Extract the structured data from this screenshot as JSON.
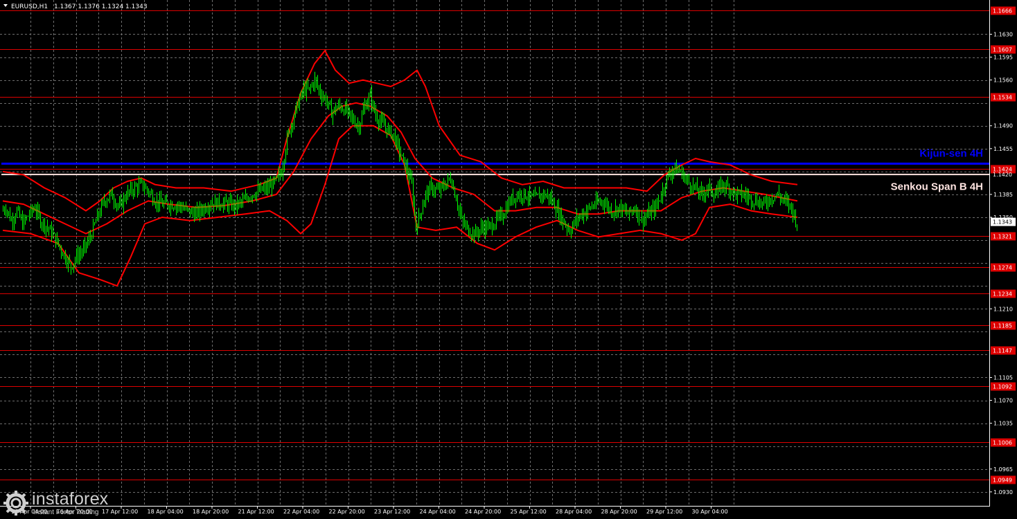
{
  "header": {
    "symbol": "EURUSD,H1",
    "ohlc": "1.1367 1.1376 1.1324 1.1343"
  },
  "watermark": {
    "brand": "instaforex",
    "tagline": "Instant Forex Trading"
  },
  "colors": {
    "background": "#000000",
    "grid": "#6e6e6e",
    "candle": "#00ff00",
    "bands": "#ff0000",
    "level": "#dd0000",
    "kijun": "#0000ff",
    "senkou": "#ffe4e1",
    "axis_text": "#ffffff",
    "label_text": "#ff3b3b"
  },
  "chart_data": {
    "type": "line",
    "title": "EURUSD,H1",
    "y_range": [
      1.0915,
      1.1676
    ],
    "y_ticks": [
      "1.1630",
      "1.1595",
      "1.1560",
      "1.1525",
      "1.1490",
      "1.1455",
      "1.1420",
      "1.1385",
      "1.1350",
      "1.1315",
      "1.1280",
      "1.1245",
      "1.1210",
      "1.1175",
      "1.1140",
      "1.1105",
      "1.1070",
      "1.1035",
      "1.1000",
      "1.0965",
      "1.0930"
    ],
    "x_tick_labels": [
      "16 Apr 04:00",
      "16 Apr 20:00",
      "17 Apr 12:00",
      "18 Apr 04:00",
      "18 Apr 20:00",
      "21 Apr 12:00",
      "22 Apr 04:00",
      "22 Apr 20:00",
      "23 Apr 12:00",
      "24 Apr 04:00",
      "24 Apr 20:00",
      "25 Apr 12:00",
      "28 Apr 04:00",
      "28 Apr 20:00",
      "29 Apr 12:00",
      "30 Apr 04:00"
    ],
    "current_price": "1.1343",
    "levels": [
      {
        "value": 1.1666,
        "label": "1.1666"
      },
      {
        "value": 1.1607,
        "label": "1.1607"
      },
      {
        "value": 1.1534,
        "label": "1.1534"
      },
      {
        "value": 1.1424,
        "label": "1.1424"
      },
      {
        "value": 1.1321,
        "label": "1.1321"
      },
      {
        "value": 1.1274,
        "label": "1.1274"
      },
      {
        "value": 1.1234,
        "label": "1.1234"
      },
      {
        "value": 1.1185,
        "label": "1.1185"
      },
      {
        "value": 1.1147,
        "label": "1.1147"
      },
      {
        "value": 1.1092,
        "label": "1.1092"
      },
      {
        "value": 1.1006,
        "label": "1.1006"
      },
      {
        "value": 1.0949,
        "label": "1.0949"
      }
    ],
    "kijun": {
      "name": "Kijun-sen 4H",
      "value": 1.1432
    },
    "senkou": {
      "name": "Senkou Span B 4H",
      "value": 1.1424
    },
    "senkou_tick": "1.1420",
    "price_path": [
      {
        "t": 0,
        "v": 1.136
      },
      {
        "t": 6,
        "v": 1.1365
      },
      {
        "t": 14,
        "v": 1.1345
      },
      {
        "t": 22,
        "v": 1.136
      },
      {
        "t": 30,
        "v": 1.134
      },
      {
        "t": 40,
        "v": 1.1355
      },
      {
        "t": 48,
        "v": 1.1365
      },
      {
        "t": 56,
        "v": 1.1345
      },
      {
        "t": 66,
        "v": 1.1335
      },
      {
        "t": 76,
        "v": 1.132
      },
      {
        "t": 86,
        "v": 1.13
      },
      {
        "t": 94,
        "v": 1.1285
      },
      {
        "t": 100,
        "v": 1.1275
      },
      {
        "t": 108,
        "v": 1.129
      },
      {
        "t": 118,
        "v": 1.13
      },
      {
        "t": 128,
        "v": 1.132
      },
      {
        "t": 138,
        "v": 1.135
      },
      {
        "t": 148,
        "v": 1.1375
      },
      {
        "t": 158,
        "v": 1.1385
      },
      {
        "t": 170,
        "v": 1.1365
      },
      {
        "t": 180,
        "v": 1.1385
      },
      {
        "t": 192,
        "v": 1.1395
      },
      {
        "t": 202,
        "v": 1.14
      },
      {
        "t": 212,
        "v": 1.139
      },
      {
        "t": 222,
        "v": 1.1375
      },
      {
        "t": 232,
        "v": 1.137
      },
      {
        "t": 244,
        "v": 1.137
      },
      {
        "t": 256,
        "v": 1.1368
      },
      {
        "t": 268,
        "v": 1.136
      },
      {
        "t": 280,
        "v": 1.1355
      },
      {
        "t": 292,
        "v": 1.1365
      },
      {
        "t": 302,
        "v": 1.1372
      },
      {
        "t": 314,
        "v": 1.1372
      },
      {
        "t": 326,
        "v": 1.137
      },
      {
        "t": 338,
        "v": 1.1368
      },
      {
        "t": 350,
        "v": 1.1375
      },
      {
        "t": 360,
        "v": 1.1385
      },
      {
        "t": 372,
        "v": 1.139
      },
      {
        "t": 384,
        "v": 1.1395
      },
      {
        "t": 396,
        "v": 1.1405
      },
      {
        "t": 404,
        "v": 1.142
      },
      {
        "t": 412,
        "v": 1.147
      },
      {
        "t": 420,
        "v": 1.15
      },
      {
        "t": 428,
        "v": 1.1525
      },
      {
        "t": 436,
        "v": 1.1545
      },
      {
        "t": 444,
        "v": 1.1545
      },
      {
        "t": 452,
        "v": 1.156
      },
      {
        "t": 460,
        "v": 1.154
      },
      {
        "t": 468,
        "v": 1.153
      },
      {
        "t": 476,
        "v": 1.151
      },
      {
        "t": 486,
        "v": 1.152
      },
      {
        "t": 496,
        "v": 1.1515
      },
      {
        "t": 506,
        "v": 1.15
      },
      {
        "t": 516,
        "v": 1.149
      },
      {
        "t": 524,
        "v": 1.152
      },
      {
        "t": 532,
        "v": 1.1535
      },
      {
        "t": 540,
        "v": 1.1505
      },
      {
        "t": 548,
        "v": 1.1495
      },
      {
        "t": 556,
        "v": 1.1485
      },
      {
        "t": 566,
        "v": 1.1475
      },
      {
        "t": 576,
        "v": 1.1445
      },
      {
        "t": 584,
        "v": 1.1425
      },
      {
        "t": 592,
        "v": 1.14
      },
      {
        "t": 598,
        "v": 1.1335
      },
      {
        "t": 604,
        "v": 1.1355
      },
      {
        "t": 612,
        "v": 1.1385
      },
      {
        "t": 620,
        "v": 1.1395
      },
      {
        "t": 630,
        "v": 1.139
      },
      {
        "t": 640,
        "v": 1.14
      },
      {
        "t": 648,
        "v": 1.141
      },
      {
        "t": 656,
        "v": 1.138
      },
      {
        "t": 664,
        "v": 1.1345
      },
      {
        "t": 674,
        "v": 1.133
      },
      {
        "t": 684,
        "v": 1.1325
      },
      {
        "t": 694,
        "v": 1.1335
      },
      {
        "t": 704,
        "v": 1.1335
      },
      {
        "t": 714,
        "v": 1.1345
      },
      {
        "t": 724,
        "v": 1.1355
      },
      {
        "t": 734,
        "v": 1.1375
      },
      {
        "t": 744,
        "v": 1.1385
      },
      {
        "t": 756,
        "v": 1.1385
      },
      {
        "t": 768,
        "v": 1.1378
      },
      {
        "t": 780,
        "v": 1.1385
      },
      {
        "t": 790,
        "v": 1.1382
      },
      {
        "t": 800,
        "v": 1.1365
      },
      {
        "t": 810,
        "v": 1.1345
      },
      {
        "t": 820,
        "v": 1.133
      },
      {
        "t": 832,
        "v": 1.135
      },
      {
        "t": 844,
        "v": 1.136
      },
      {
        "t": 856,
        "v": 1.137
      },
      {
        "t": 868,
        "v": 1.1375
      },
      {
        "t": 880,
        "v": 1.136
      },
      {
        "t": 892,
        "v": 1.1365
      },
      {
        "t": 904,
        "v": 1.1355
      },
      {
        "t": 914,
        "v": 1.1365
      },
      {
        "t": 924,
        "v": 1.1345
      },
      {
        "t": 934,
        "v": 1.1355
      },
      {
        "t": 944,
        "v": 1.1365
      },
      {
        "t": 952,
        "v": 1.1385
      },
      {
        "t": 960,
        "v": 1.141
      },
      {
        "t": 970,
        "v": 1.1425
      },
      {
        "t": 980,
        "v": 1.142
      },
      {
        "t": 990,
        "v": 1.1405
      },
      {
        "t": 1000,
        "v": 1.1395
      },
      {
        "t": 1010,
        "v": 1.1385
      },
      {
        "t": 1020,
        "v": 1.1395
      },
      {
        "t": 1030,
        "v": 1.1385
      },
      {
        "t": 1040,
        "v": 1.14
      },
      {
        "t": 1050,
        "v": 1.1395
      },
      {
        "t": 1060,
        "v": 1.1385
      },
      {
        "t": 1070,
        "v": 1.1385
      },
      {
        "t": 1080,
        "v": 1.138
      },
      {
        "t": 1090,
        "v": 1.1375
      },
      {
        "t": 1100,
        "v": 1.137
      },
      {
        "t": 1110,
        "v": 1.138
      },
      {
        "t": 1120,
        "v": 1.1385
      },
      {
        "t": 1130,
        "v": 1.1375
      },
      {
        "t": 1140,
        "v": 1.1365
      },
      {
        "t": 1147,
        "v": 1.1343
      }
    ],
    "upper_band": [
      {
        "t": 0,
        "v": 1.142
      },
      {
        "t": 30,
        "v": 1.1415
      },
      {
        "t": 60,
        "v": 1.1395
      },
      {
        "t": 90,
        "v": 1.138
      },
      {
        "t": 120,
        "v": 1.136
      },
      {
        "t": 140,
        "v": 1.1375
      },
      {
        "t": 160,
        "v": 1.1395
      },
      {
        "t": 180,
        "v": 1.1405
      },
      {
        "t": 200,
        "v": 1.141
      },
      {
        "t": 220,
        "v": 1.14
      },
      {
        "t": 250,
        "v": 1.1395
      },
      {
        "t": 290,
        "v": 1.1395
      },
      {
        "t": 330,
        "v": 1.139
      },
      {
        "t": 370,
        "v": 1.14
      },
      {
        "t": 395,
        "v": 1.141
      },
      {
        "t": 410,
        "v": 1.147
      },
      {
        "t": 430,
        "v": 1.154
      },
      {
        "t": 450,
        "v": 1.1585
      },
      {
        "t": 465,
        "v": 1.1605
      },
      {
        "t": 480,
        "v": 1.1575
      },
      {
        "t": 500,
        "v": 1.1555
      },
      {
        "t": 520,
        "v": 1.156
      },
      {
        "t": 540,
        "v": 1.1555
      },
      {
        "t": 560,
        "v": 1.155
      },
      {
        "t": 580,
        "v": 1.156
      },
      {
        "t": 598,
        "v": 1.1575
      },
      {
        "t": 610,
        "v": 1.155
      },
      {
        "t": 630,
        "v": 1.149
      },
      {
        "t": 660,
        "v": 1.1445
      },
      {
        "t": 690,
        "v": 1.1435
      },
      {
        "t": 720,
        "v": 1.141
      },
      {
        "t": 750,
        "v": 1.14
      },
      {
        "t": 780,
        "v": 1.1405
      },
      {
        "t": 810,
        "v": 1.1395
      },
      {
        "t": 840,
        "v": 1.1395
      },
      {
        "t": 870,
        "v": 1.1395
      },
      {
        "t": 900,
        "v": 1.1395
      },
      {
        "t": 930,
        "v": 1.139
      },
      {
        "t": 955,
        "v": 1.1415
      },
      {
        "t": 980,
        "v": 1.143
      },
      {
        "t": 1000,
        "v": 1.144
      },
      {
        "t": 1020,
        "v": 1.1435
      },
      {
        "t": 1050,
        "v": 1.143
      },
      {
        "t": 1080,
        "v": 1.1415
      },
      {
        "t": 1110,
        "v": 1.1405
      },
      {
        "t": 1147,
        "v": 1.14
      }
    ],
    "middle_band": [
      {
        "t": 0,
        "v": 1.1375
      },
      {
        "t": 30,
        "v": 1.137
      },
      {
        "t": 60,
        "v": 1.1355
      },
      {
        "t": 90,
        "v": 1.134
      },
      {
        "t": 120,
        "v": 1.1325
      },
      {
        "t": 150,
        "v": 1.134
      },
      {
        "t": 180,
        "v": 1.136
      },
      {
        "t": 210,
        "v": 1.1375
      },
      {
        "t": 240,
        "v": 1.137
      },
      {
        "t": 280,
        "v": 1.1365
      },
      {
        "t": 320,
        "v": 1.1368
      },
      {
        "t": 360,
        "v": 1.1375
      },
      {
        "t": 395,
        "v": 1.1385
      },
      {
        "t": 420,
        "v": 1.142
      },
      {
        "t": 445,
        "v": 1.147
      },
      {
        "t": 470,
        "v": 1.1505
      },
      {
        "t": 490,
        "v": 1.152
      },
      {
        "t": 510,
        "v": 1.1525
      },
      {
        "t": 530,
        "v": 1.152
      },
      {
        "t": 555,
        "v": 1.1505
      },
      {
        "t": 575,
        "v": 1.148
      },
      {
        "t": 595,
        "v": 1.144
      },
      {
        "t": 620,
        "v": 1.141
      },
      {
        "t": 650,
        "v": 1.1395
      },
      {
        "t": 680,
        "v": 1.1385
      },
      {
        "t": 710,
        "v": 1.136
      },
      {
        "t": 740,
        "v": 1.136
      },
      {
        "t": 770,
        "v": 1.1365
      },
      {
        "t": 800,
        "v": 1.1365
      },
      {
        "t": 830,
        "v": 1.1355
      },
      {
        "t": 860,
        "v": 1.1355
      },
      {
        "t": 890,
        "v": 1.136
      },
      {
        "t": 920,
        "v": 1.136
      },
      {
        "t": 950,
        "v": 1.136
      },
      {
        "t": 980,
        "v": 1.138
      },
      {
        "t": 1010,
        "v": 1.139
      },
      {
        "t": 1040,
        "v": 1.1395
      },
      {
        "t": 1070,
        "v": 1.139
      },
      {
        "t": 1100,
        "v": 1.1385
      },
      {
        "t": 1147,
        "v": 1.1375
      }
    ],
    "lower_band": [
      {
        "t": 0,
        "v": 1.133
      },
      {
        "t": 40,
        "v": 1.1325
      },
      {
        "t": 80,
        "v": 1.131
      },
      {
        "t": 110,
        "v": 1.1265
      },
      {
        "t": 140,
        "v": 1.1255
      },
      {
        "t": 165,
        "v": 1.1245
      },
      {
        "t": 185,
        "v": 1.129
      },
      {
        "t": 205,
        "v": 1.134
      },
      {
        "t": 230,
        "v": 1.135
      },
      {
        "t": 270,
        "v": 1.1345
      },
      {
        "t": 310,
        "v": 1.135
      },
      {
        "t": 350,
        "v": 1.1355
      },
      {
        "t": 385,
        "v": 1.136
      },
      {
        "t": 410,
        "v": 1.1345
      },
      {
        "t": 430,
        "v": 1.1325
      },
      {
        "t": 445,
        "v": 1.134
      },
      {
        "t": 465,
        "v": 1.14
      },
      {
        "t": 485,
        "v": 1.147
      },
      {
        "t": 505,
        "v": 1.149
      },
      {
        "t": 535,
        "v": 1.149
      },
      {
        "t": 560,
        "v": 1.1475
      },
      {
        "t": 580,
        "v": 1.143
      },
      {
        "t": 598,
        "v": 1.1335
      },
      {
        "t": 625,
        "v": 1.133
      },
      {
        "t": 655,
        "v": 1.1335
      },
      {
        "t": 685,
        "v": 1.131
      },
      {
        "t": 710,
        "v": 1.13
      },
      {
        "t": 740,
        "v": 1.132
      },
      {
        "t": 770,
        "v": 1.1335
      },
      {
        "t": 800,
        "v": 1.1345
      },
      {
        "t": 830,
        "v": 1.133
      },
      {
        "t": 860,
        "v": 1.132
      },
      {
        "t": 890,
        "v": 1.1325
      },
      {
        "t": 920,
        "v": 1.133
      },
      {
        "t": 950,
        "v": 1.1325
      },
      {
        "t": 980,
        "v": 1.1315
      },
      {
        "t": 1000,
        "v": 1.1325
      },
      {
        "t": 1020,
        "v": 1.1365
      },
      {
        "t": 1050,
        "v": 1.137
      },
      {
        "t": 1080,
        "v": 1.136
      },
      {
        "t": 1110,
        "v": 1.1355
      },
      {
        "t": 1147,
        "v": 1.135
      }
    ]
  }
}
